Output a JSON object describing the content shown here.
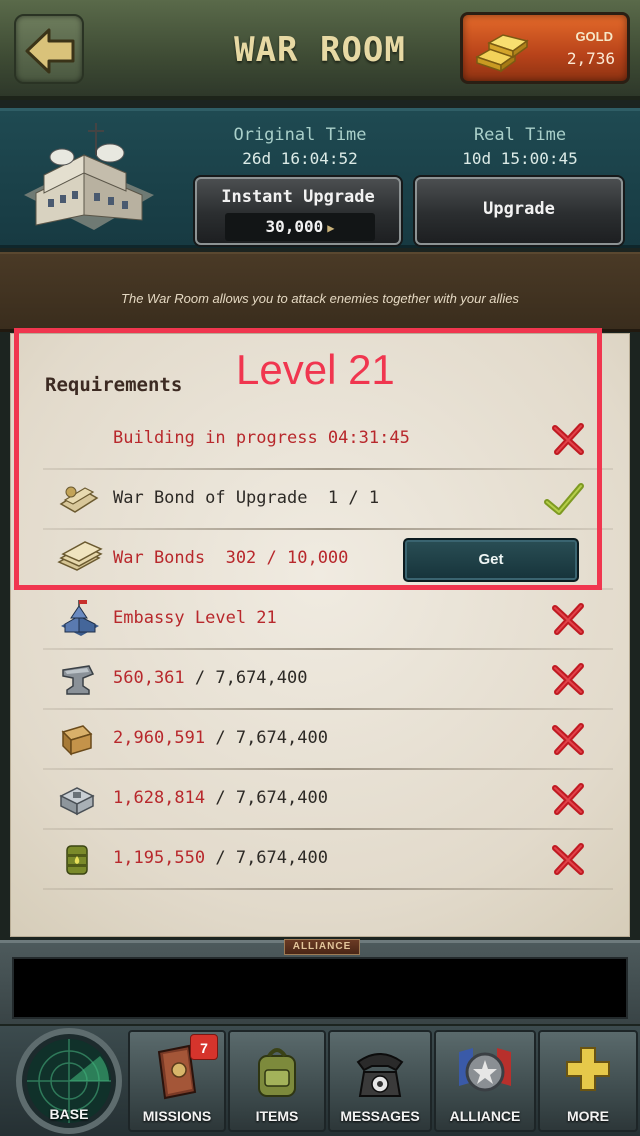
{
  "header": {
    "title": "WAR ROOM",
    "gold_label": "GOLD",
    "gold_amount": "2,736"
  },
  "building": {
    "original_time_label": "Original Time",
    "original_time_value": "26d 16:04:52",
    "real_time_label": "Real Time",
    "real_time_value": "10d 15:00:45",
    "instant_upgrade_label": "Instant Upgrade",
    "instant_upgrade_cost": "30,000",
    "upgrade_label": "Upgrade"
  },
  "description": "The War Room allows you to attack enemies together with your allies",
  "annotation": {
    "label": "Level 21",
    "color": "#f0364f"
  },
  "requirements": {
    "title": "Requirements",
    "rows": [
      {
        "text": "Building in progress 04:31:45",
        "met": false
      },
      {
        "text": "War Bond of Upgrade  1 / 1",
        "met": true
      },
      {
        "text": "War Bonds  302 / 10,000",
        "met": false,
        "action": "Get"
      },
      {
        "text": "Embassy Level 21",
        "met": false
      },
      {
        "have": "560,361",
        "need": " / 7,674,400",
        "met": false
      },
      {
        "have": "2,960,591",
        "need": " / 7,674,400",
        "met": false
      },
      {
        "have": "1,628,814",
        "need": " / 7,674,400",
        "met": false
      },
      {
        "have": "1,195,550",
        "need": " / 7,674,400",
        "met": false
      }
    ]
  },
  "chat": {
    "tab_label": "ALLIANCE"
  },
  "nav": {
    "base": "BASE",
    "missions": "MISSIONS",
    "missions_badge": "7",
    "items": "ITEMS",
    "messages": "MESSAGES",
    "alliance": "ALLIANCE",
    "more": "MORE"
  }
}
